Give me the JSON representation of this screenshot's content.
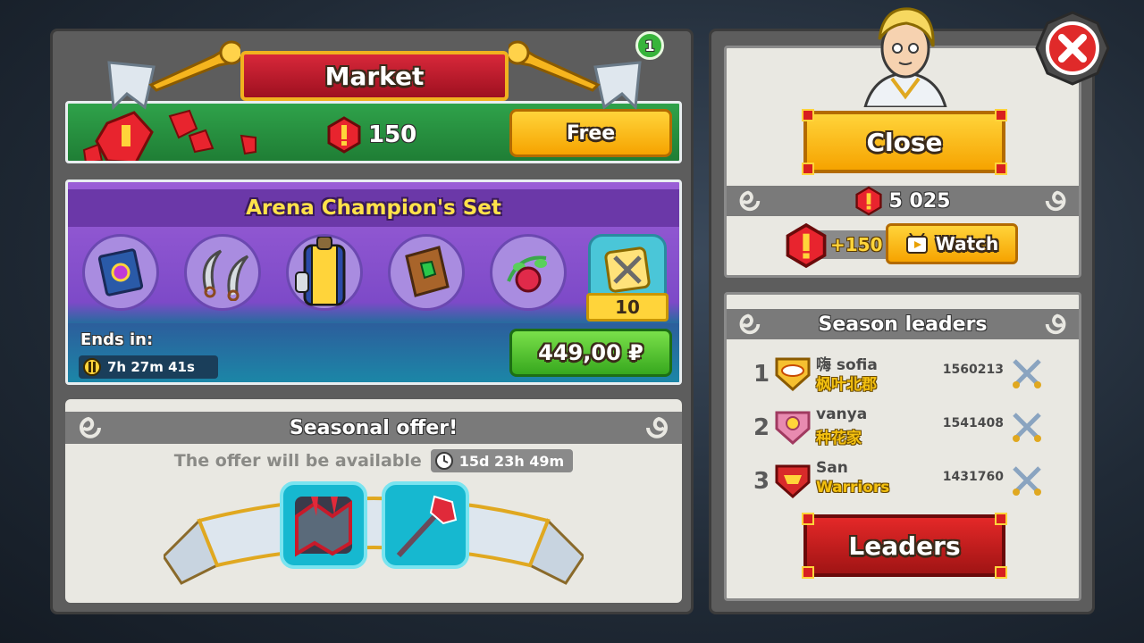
{
  "market": {
    "title": "Market",
    "gem_reward": "150",
    "free_button": "Free",
    "free_badge": "1"
  },
  "arena_set": {
    "title": "Arena Champion's Set",
    "items": [
      "spellbook-icon",
      "twin-sickles-icon",
      "armor-icon",
      "wooden-shield-icon",
      "berry-vine-icon"
    ],
    "ticket_count": "10",
    "ends_label": "Ends in:",
    "ends_timer": "7h 27m 41s",
    "price": "449,00 ₽"
  },
  "seasonal": {
    "title": "Seasonal offer!",
    "available_msg": "The offer will be available",
    "timer": "15d 23h 49m"
  },
  "right_top": {
    "close_label": "Close",
    "gem_balance": "5 025",
    "watch_bonus": "+150",
    "watch_label": "Watch"
  },
  "leaders": {
    "title": "Season leaders",
    "rows": [
      {
        "rank": "1",
        "name": "嗨 sofia",
        "guild": "枫叶北郡",
        "score": "1560213"
      },
      {
        "rank": "2",
        "name": "vanya",
        "guild": "种花家",
        "score": "1541408"
      },
      {
        "rank": "3",
        "name": "San",
        "guild": "Warriors",
        "score": "1431760"
      }
    ],
    "button_label": "Leaders"
  },
  "colors": {
    "gold_button": "#f6a300",
    "green_button": "#37a81e",
    "red_button": "#a01414",
    "panel_gray": "#5d5d5d",
    "purple": "#7d4ac8"
  }
}
